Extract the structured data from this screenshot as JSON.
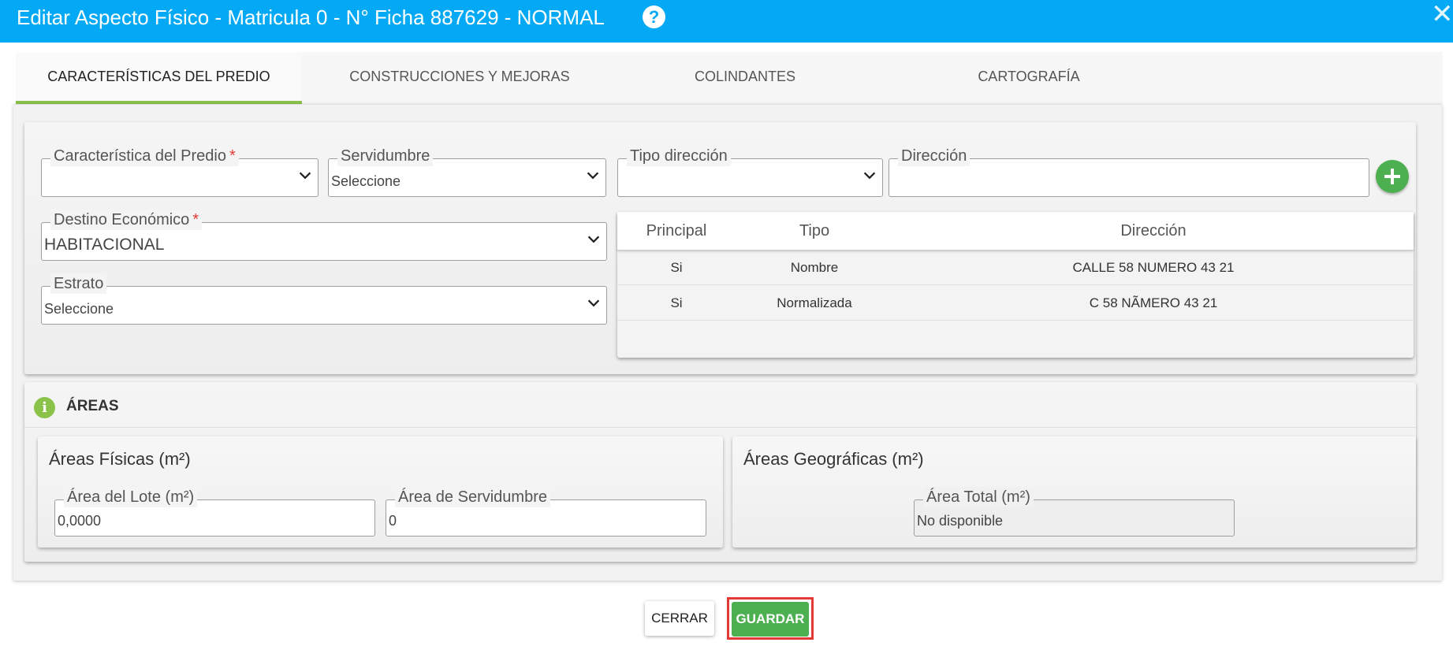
{
  "window": {
    "title": "Editar Aspecto Físico - Matricula 0 - N° Ficha 887629 - NORMAL",
    "help_icon": "help-icon",
    "close_icon": "close-icon",
    "accent_color": "#03a9f4"
  },
  "tabs": [
    {
      "label": "CARACTERÍSTICAS DEL PREDIO",
      "active": true
    },
    {
      "label": "CONSTRUCCIONES Y MEJORAS",
      "active": false
    },
    {
      "label": "COLINDANTES",
      "active": false
    },
    {
      "label": "CARTOGRAFÍA",
      "active": false
    }
  ],
  "form": {
    "caracteristica": {
      "label": "Característica del Predio",
      "required_mark": "*",
      "value": ""
    },
    "servidumbre": {
      "label": "Servidumbre",
      "value": "Seleccione"
    },
    "tipo_direccion": {
      "label": "Tipo dirección",
      "value": ""
    },
    "direccion": {
      "label": "Dirección",
      "value": ""
    },
    "destino": {
      "label": "Destino Económico",
      "required_mark": "*",
      "value": "HABITACIONAL"
    },
    "estrato": {
      "label": "Estrato",
      "value": "Seleccione"
    },
    "add_icon": "plus-icon"
  },
  "address_table": {
    "headers": [
      "Principal",
      "Tipo",
      "Dirección"
    ],
    "rows": [
      [
        "Si",
        "Nombre",
        "CALLE 58 NUMERO 43 21"
      ],
      [
        "Si",
        "Normalizada",
        "C 58 NÃMERO 43 21"
      ]
    ]
  },
  "areas": {
    "title": "ÁREAS",
    "info_icon": "info-icon",
    "fisicas": {
      "title": "Áreas Físicas (m²)",
      "lote": {
        "label": "Área del Lote (m²)",
        "value": "0,0000"
      },
      "servidumbre": {
        "label": "Área de Servidumbre",
        "value": "0"
      }
    },
    "geograficas": {
      "title": "Áreas Geográficas (m²)",
      "total": {
        "label": "Área Total (m²)",
        "value": "No disponible"
      }
    }
  },
  "footer": {
    "cerrar_label": "CERRAR",
    "guardar_label": "GUARDAR",
    "primary_color": "#4caf50"
  }
}
